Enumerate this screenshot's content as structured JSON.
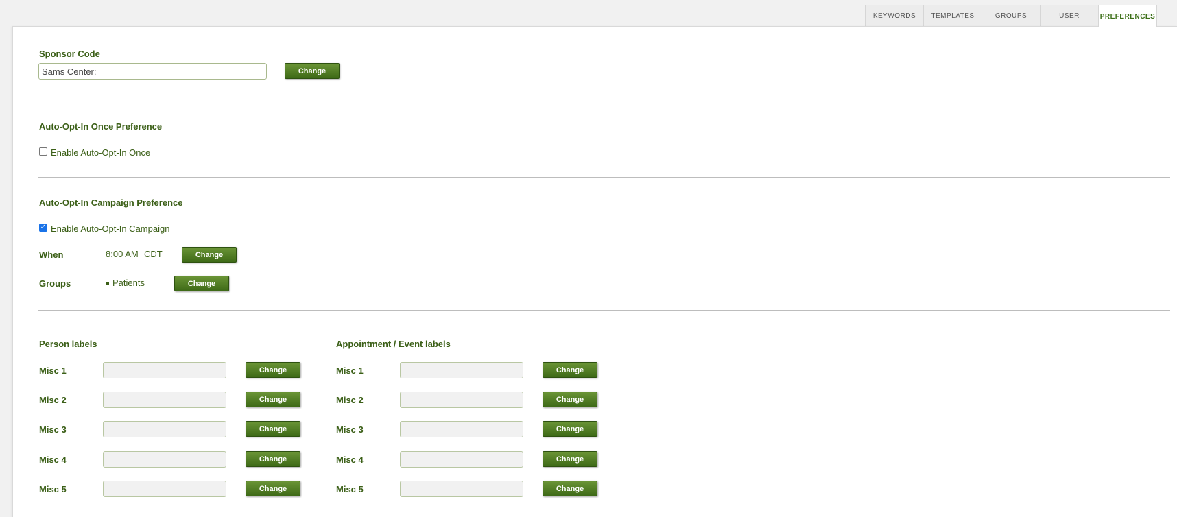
{
  "tabs": [
    {
      "label": "KEYWORDS",
      "active": false
    },
    {
      "label": "TEMPLATES",
      "active": false
    },
    {
      "label": "GROUPS",
      "active": false
    },
    {
      "label": "USER",
      "active": false
    },
    {
      "label": "PREFERENCES",
      "active": true
    }
  ],
  "sponsor": {
    "title": "Sponsor Code",
    "value": "Sams Center:",
    "button": "Change"
  },
  "auto_once": {
    "title": "Auto-Opt-In Once Preference",
    "checkbox_label": "Enable Auto-Opt-In Once",
    "checked": false
  },
  "auto_campaign": {
    "title": "Auto-Opt-In Campaign Preference",
    "checkbox_label": "Enable Auto-Opt-In Campaign",
    "checked": true,
    "when_label": "When",
    "time": "8:00 AM",
    "timezone": "CDT",
    "when_button": "Change",
    "groups_label": "Groups",
    "group_item": "Patients",
    "groups_button": "Change"
  },
  "person_labels": {
    "title": "Person labels",
    "rows": [
      {
        "label": "Misc 1",
        "value": "",
        "button": "Change"
      },
      {
        "label": "Misc 2",
        "value": "",
        "button": "Change"
      },
      {
        "label": "Misc 3",
        "value": "",
        "button": "Change"
      },
      {
        "label": "Misc 4",
        "value": "",
        "button": "Change"
      },
      {
        "label": "Misc 5",
        "value": "",
        "button": "Change"
      }
    ]
  },
  "event_labels": {
    "title": "Appointment / Event labels",
    "rows": [
      {
        "label": "Misc 1",
        "value": "",
        "button": "Change"
      },
      {
        "label": "Misc 2",
        "value": "",
        "button": "Change"
      },
      {
        "label": "Misc 3",
        "value": "",
        "button": "Change"
      },
      {
        "label": "Misc 4",
        "value": "",
        "button": "Change"
      },
      {
        "label": "Misc 5",
        "value": "",
        "button": "Change"
      }
    ]
  },
  "colors": {
    "accent_green": "#3b5f17",
    "button_top": "#6a9436",
    "button_bottom": "#3e6a17"
  }
}
